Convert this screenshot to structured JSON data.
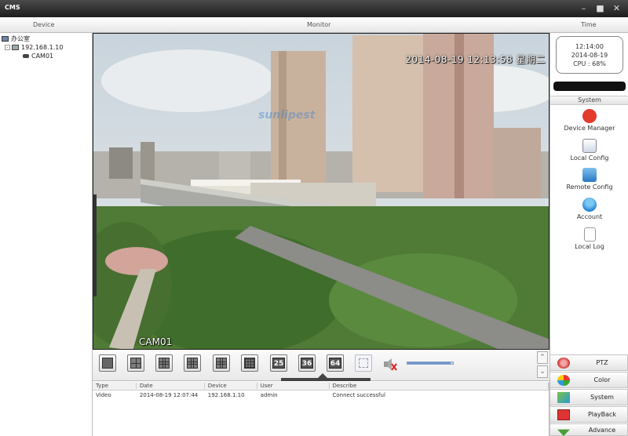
{
  "window": {
    "title": "CMS",
    "controls": [
      "minimize-icon",
      "maximize-icon",
      "close-icon"
    ]
  },
  "columns": {
    "device": "Device",
    "monitor": "Monitor",
    "time": "Time"
  },
  "tree": {
    "group": "办公室",
    "device": "192.168.1.10",
    "camera": "CAM01"
  },
  "video": {
    "timestamp": "2014-08-19 12:13:58 星期二",
    "camera_label": "CAM01",
    "watermark": "sunlipest"
  },
  "toolbar": {
    "layout_buttons": [
      "1",
      "4",
      "6",
      "8",
      "9",
      "16",
      "25",
      "36",
      "64"
    ],
    "fullscreen": "fullscreen-icon",
    "mute": "mute-icon",
    "volume_percent": 95
  },
  "log": {
    "headers": [
      "Type",
      "Date",
      "Device",
      "User",
      "Describe"
    ],
    "rows": [
      [
        "Video",
        "2014-08-19 12:07:44",
        "192.168.1.10",
        "admin",
        "Connect successful"
      ]
    ]
  },
  "clock": {
    "time": "12:14:00",
    "date": "2014-08-19",
    "cpu": "CPU : 68%"
  },
  "system": {
    "header": "System",
    "items": [
      {
        "label": "Device Manager",
        "icon": "device-manager-icon",
        "color": "#e33a2b"
      },
      {
        "label": "Local Config",
        "icon": "local-config-icon",
        "color": "#5a8fd0"
      },
      {
        "label": "Remote Config",
        "icon": "remote-config-icon",
        "color": "#3c9ad6"
      },
      {
        "label": "Account",
        "icon": "account-icon",
        "color": "#4aa3e0"
      },
      {
        "label": "Local Log",
        "icon": "local-log-icon",
        "color": "#eee"
      }
    ]
  },
  "nav": [
    {
      "label": "PTZ",
      "icon": "ptz-icon"
    },
    {
      "label": "Color",
      "icon": "color-icon"
    },
    {
      "label": "System",
      "icon": "system-icon"
    },
    {
      "label": "PlayBack",
      "icon": "playback-icon"
    },
    {
      "label": "Advance",
      "icon": "advance-icon"
    }
  ]
}
